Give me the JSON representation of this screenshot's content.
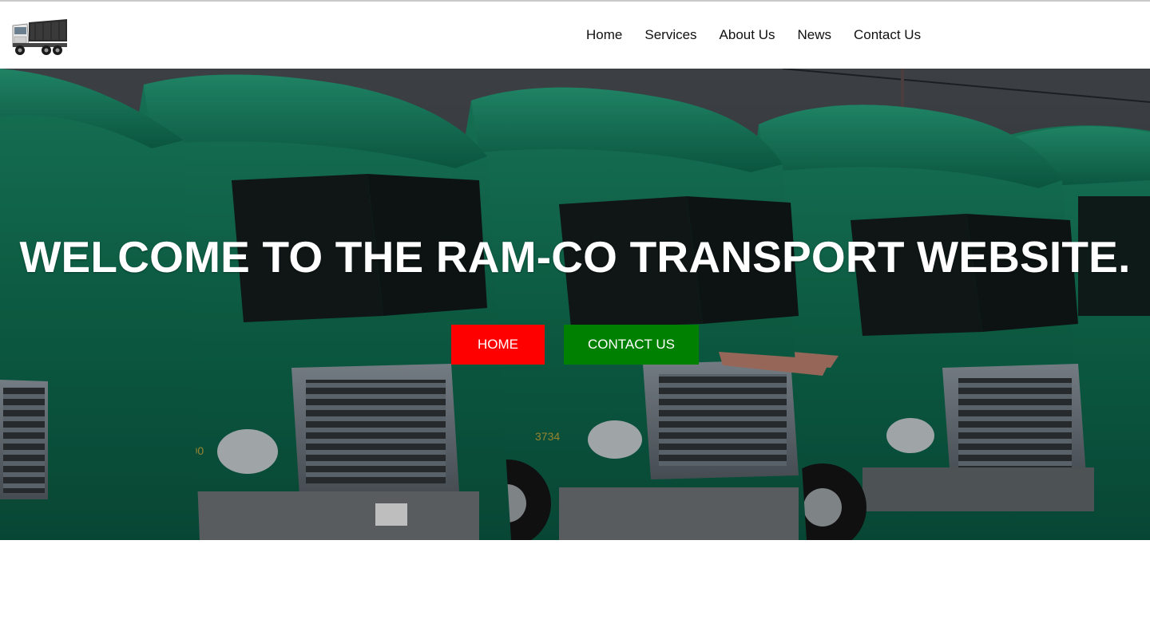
{
  "nav": {
    "logo": "dump-truck-logo",
    "links": [
      "Home",
      "Services",
      "About Us",
      "News",
      "Contact Us"
    ]
  },
  "hero": {
    "title": "WELCOME TO THE RAM-CO TRANSPORT WEBSITE.",
    "background": "green-freight-trucks-photo",
    "buttons": {
      "home": "HOME",
      "contact": "CONTACT US"
    }
  },
  "colors": {
    "home_button": "#ff0000",
    "contact_button": "#008000",
    "truck_green": "#0e6b4f",
    "overlay": "#000000"
  }
}
